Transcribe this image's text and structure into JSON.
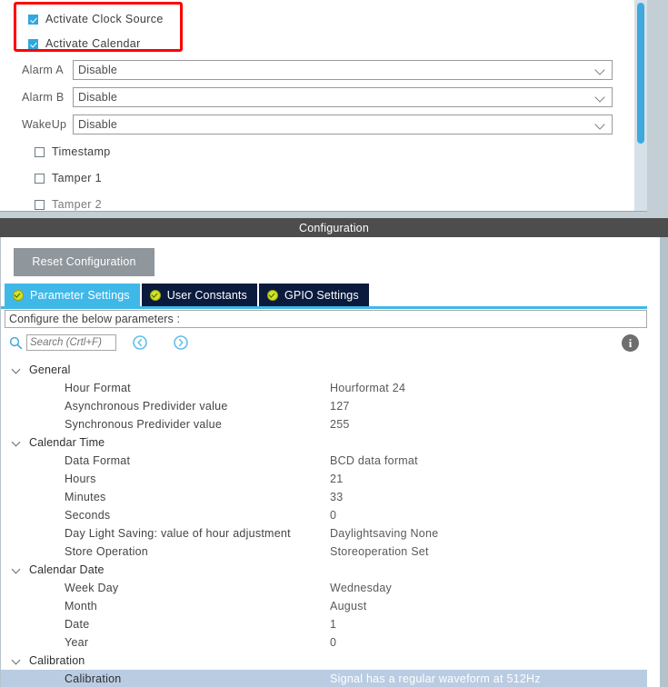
{
  "top_panel": {
    "checkboxes_top": [
      {
        "label": "Activate Clock Source",
        "checked": true
      },
      {
        "label": "Activate Calendar",
        "checked": true
      }
    ],
    "combos": [
      {
        "label": "Alarm A",
        "value": "Disable"
      },
      {
        "label": "Alarm B",
        "value": "Disable"
      },
      {
        "label": "WakeUp",
        "value": "Disable"
      }
    ],
    "checkboxes_bottom": [
      {
        "label": "Timestamp",
        "checked": false
      },
      {
        "label": "Tamper 1",
        "checked": false
      },
      {
        "label": "Tamper 2",
        "checked": false
      }
    ]
  },
  "config": {
    "titlebar": "Configuration",
    "reset_label": "Reset Configuration",
    "tabs": [
      {
        "label": "Parameter Settings",
        "active": true
      },
      {
        "label": "User Constants",
        "active": false
      },
      {
        "label": "GPIO Settings",
        "active": false
      }
    ],
    "hint": "Configure the below parameters :",
    "search_placeholder": "Search (Crtl+F)",
    "search_value": "",
    "info_glyph": "i"
  },
  "tree": [
    {
      "type": "group",
      "label": "General"
    },
    {
      "type": "param",
      "label": "Hour Format",
      "value": "Hourformat 24"
    },
    {
      "type": "param",
      "label": "Asynchronous Predivider value",
      "value": "127"
    },
    {
      "type": "param",
      "label": "Synchronous Predivider value",
      "value": "255"
    },
    {
      "type": "group",
      "label": "Calendar Time"
    },
    {
      "type": "param",
      "label": "Data Format",
      "value": "BCD data format"
    },
    {
      "type": "param",
      "label": "Hours",
      "value": "21"
    },
    {
      "type": "param",
      "label": "Minutes",
      "value": "33"
    },
    {
      "type": "param",
      "label": "Seconds",
      "value": "0"
    },
    {
      "type": "param",
      "label": "Day Light Saving: value of hour adjustment",
      "value": "Daylightsaving None"
    },
    {
      "type": "param",
      "label": "Store Operation",
      "value": "Storeoperation Set"
    },
    {
      "type": "group",
      "label": "Calendar Date"
    },
    {
      "type": "param",
      "label": "Week Day",
      "value": "Wednesday"
    },
    {
      "type": "param",
      "label": "Month",
      "value": "August"
    },
    {
      "type": "param",
      "label": "Date",
      "value": "1"
    },
    {
      "type": "param",
      "label": "Year",
      "value": "0"
    },
    {
      "type": "group",
      "label": "Calibration"
    },
    {
      "type": "param",
      "label": "Calibration",
      "value": "Signal has a regular waveform at 512Hz",
      "selected": true
    }
  ],
  "colors": {
    "accent_blue": "#3fb8e8",
    "tab_inactive": "#0a1b3d",
    "titlebar": "#4d4d4d",
    "highlight_red": "#ff0000",
    "selected_row": "#b9cce2",
    "reset_button": "#8f969c"
  }
}
